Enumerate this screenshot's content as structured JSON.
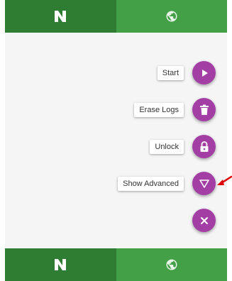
{
  "colors": {
    "tab_dark": "#2e7d32",
    "tab_light": "#43a047",
    "fab": "#a23ea4",
    "background": "#f5f5f5",
    "annotation_arrow": "#e00000"
  },
  "top_tabs": [
    {
      "icon": "app-logo-icon"
    },
    {
      "icon": "globe-icon"
    }
  ],
  "bottom_tabs": [
    {
      "icon": "app-logo-icon"
    },
    {
      "icon": "globe-icon"
    }
  ],
  "fab_menu": {
    "items": [
      {
        "label": "Start",
        "icon": "play-icon"
      },
      {
        "label": "Erase Logs",
        "icon": "trash-icon"
      },
      {
        "label": "Unlock",
        "icon": "lock-icon"
      },
      {
        "label": "Show Advanced",
        "icon": "triangle-down-icon"
      }
    ],
    "close_icon": "close-icon"
  }
}
